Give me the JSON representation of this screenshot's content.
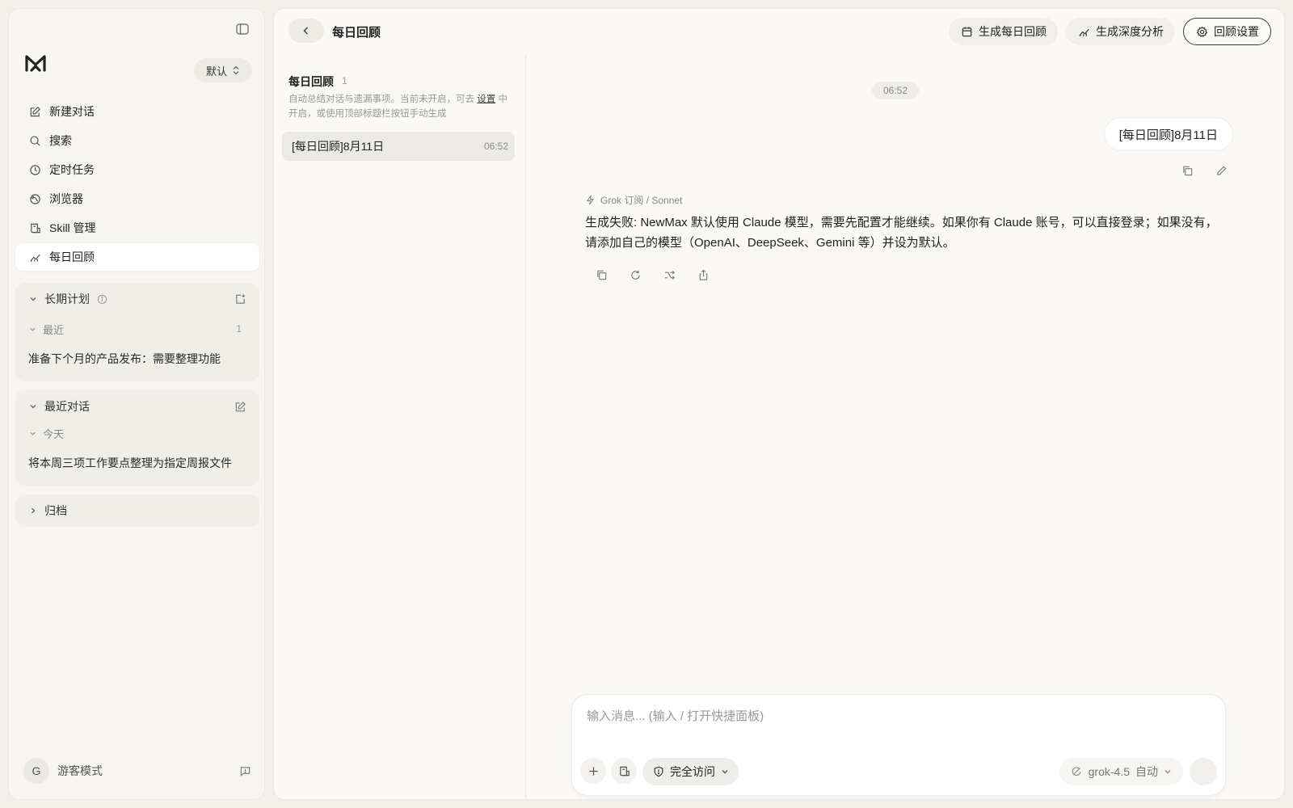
{
  "sidebar": {
    "profile": "默认",
    "nav": [
      {
        "label": "新建对话",
        "icon": "edit-icon"
      },
      {
        "label": "搜索",
        "icon": "search-icon"
      },
      {
        "label": "定时任务",
        "icon": "clock-icon"
      },
      {
        "label": "浏览器",
        "icon": "globe-icon"
      },
      {
        "label": "Skill 管理",
        "icon": "skill-icon"
      },
      {
        "label": "每日回顾",
        "icon": "chart-icon"
      }
    ],
    "long_term": {
      "title": "长期计划",
      "sub": "最近",
      "sub_count": "1",
      "item": "准备下个月的产品发布：需要整理功能"
    },
    "recent": {
      "title": "最近对话",
      "sub": "今天",
      "item": "将本周三项工作要点整理为指定周报文件"
    },
    "archive": {
      "title": "归档"
    },
    "user": {
      "initial": "G",
      "name": "游客模式"
    }
  },
  "header": {
    "title": "每日回顾",
    "actions": {
      "daily": "生成每日回顾",
      "deep": "生成深度分析",
      "settings": "回顾设置"
    }
  },
  "list": {
    "title": "每日回顾",
    "count": "1",
    "desc_before": "自动总结对话与遗漏事项。当前未开启，可去 ",
    "desc_link": "设置",
    "desc_after": " 中开启，或使用顶部标题栏按钮手动生成",
    "item": {
      "title": "[每日回顾]8月11日",
      "time": "06:52"
    }
  },
  "chat": {
    "time": "06:52",
    "user_message": "[每日回顾]8月11日",
    "model_meta": "Grok 订阅 / Sonnet",
    "reply": "生成失败: NewMax 默认使用 Claude 模型，需要先配置才能继续。如果你有 Claude 账号，可以直接登录；如果没有，请添加自己的模型（OpenAI、DeepSeek、Gemini 等）并设为默认。"
  },
  "composer": {
    "placeholder": "输入消息... (输入 / 打开快捷面板)",
    "access": "完全访问",
    "model": "grok-4.5",
    "mode": "自动"
  }
}
